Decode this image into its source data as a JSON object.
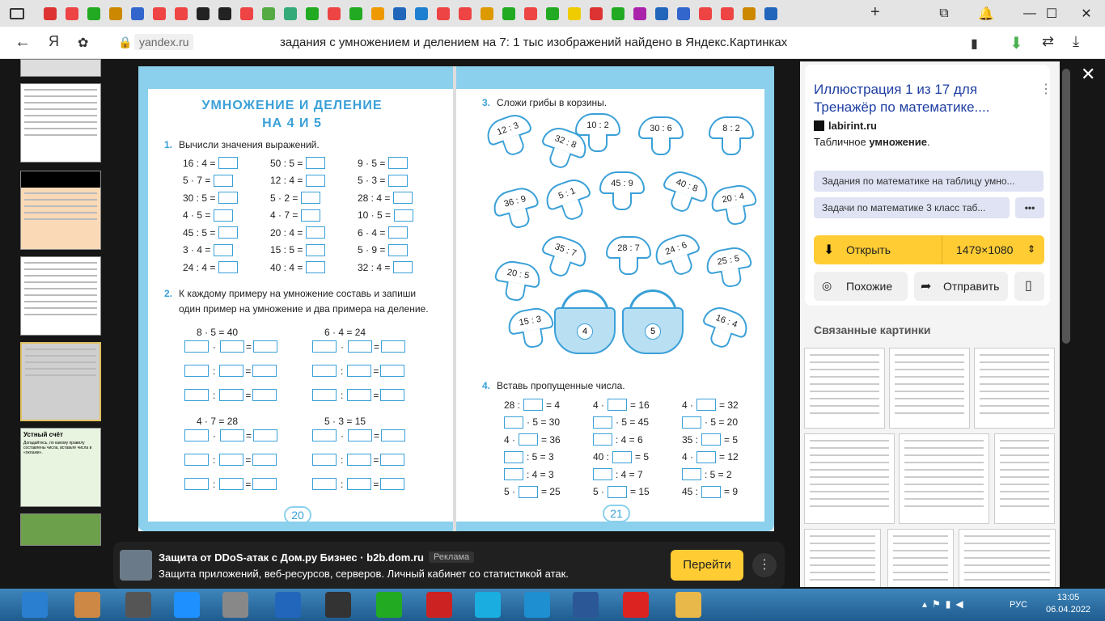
{
  "browser": {
    "address_domain": "yandex.ru",
    "page_title": "задания с умножением и делением на 7: 1 тыс изображений найдено в Яндекс.Картинках"
  },
  "book": {
    "left": {
      "heading1": "УМНОЖЕНИЕ И ДЕЛЕНИЕ",
      "heading2": "НА 4 И 5",
      "task1_num": "1.",
      "task1_text": "Вычисли значения выражений.",
      "col1": [
        "16 : 4 =",
        "5 · 7 =",
        "30 : 5 =",
        "4 · 5 =",
        "45 : 5 =",
        "3 · 4 =",
        "24 : 4 ="
      ],
      "col2": [
        "50 : 5 =",
        "12 : 4 =",
        "5 · 2 =",
        "4 · 7 =",
        "20 : 4 =",
        "15 : 5 =",
        "40 : 4 ="
      ],
      "col3": [
        "9 · 5 =",
        "5 · 3 =",
        "28 : 4 =",
        "10 · 5 =",
        "6 · 4 =",
        "5 · 9 =",
        "32 : 4 ="
      ],
      "task2_num": "2.",
      "task2_text": "К каждому примеру на умножение составь и запиши один пример на умножение и два примера на деление.",
      "examples": [
        "8 · 5 = 40",
        "6 · 4 = 24",
        "4 · 7 = 28",
        "5 · 3 = 15"
      ],
      "page": "20"
    },
    "right": {
      "task3_num": "3.",
      "task3_text": "Сложи грибы в корзины.",
      "mushrooms": [
        "12 : 3",
        "10 : 2",
        "30 : 6",
        "8 : 2",
        "32 : 8",
        "36 : 9",
        "5 : 1",
        "45 : 9",
        "40 : 8",
        "20 : 4",
        "35 : 7",
        "28 : 7",
        "24 : 6",
        "25 : 5",
        "20 : 5",
        "15 : 3",
        "16 : 4"
      ],
      "baskets": [
        "4",
        "5"
      ],
      "task4_num": "4.",
      "task4_text": "Вставь пропущенные числа.",
      "col1": [
        [
          "28 :",
          "= 4"
        ],
        [
          "",
          "· 5 = 30"
        ],
        [
          "4 ·",
          "= 36"
        ],
        [
          "",
          ": 5 = 3"
        ],
        [
          "",
          ": 4 = 3"
        ],
        [
          "5 ·",
          "= 25"
        ]
      ],
      "col2": [
        [
          "4 ·",
          "= 16"
        ],
        [
          "",
          "· 5 = 45"
        ],
        [
          "",
          ": 4 = 6"
        ],
        [
          "40 :",
          "= 5"
        ],
        [
          "",
          ": 4 = 7"
        ],
        [
          "5 ·",
          "= 15"
        ]
      ],
      "col3": [
        [
          "4 ·",
          "= 32"
        ],
        [
          "",
          "· 5 = 20"
        ],
        [
          "35 :",
          "= 5"
        ],
        [
          "4 ·",
          "= 12"
        ],
        [
          "",
          ": 5 = 2"
        ],
        [
          "45 :",
          "= 9"
        ]
      ],
      "page": "21"
    }
  },
  "thumbnail_texts": {
    "ustny": "Устный счёт",
    "ustny_sub": "Догадайтесь, по какому правилу составлены числа, вставьте числа в «окошки»."
  },
  "panel": {
    "title": "Иллюстрация 1 из 17 для Тренажёр по математике....",
    "source": "labirint.ru",
    "desc_prefix": "Табличное ",
    "desc_bold": "умножение",
    "desc_suffix": ".",
    "chip1": "Задания по математике на таблицу умно...",
    "chip2": "Задачи по математике 3 класс таб...",
    "more": "•••",
    "open_label": "Открыть",
    "size": "1479×1080",
    "similar": "Похожие",
    "share": "Отправить",
    "related": "Связанные картинки"
  },
  "ad": {
    "title": "Защита от DDoS-атак с Дом.ру Бизнес · b2b.dom.ru",
    "badge": "Реклама",
    "text": "Защита приложений, веб-ресурсов, серверов. Личный кабинет со статистикой атак.",
    "button": "Перейти"
  },
  "taskbar": {
    "lang": "РУС",
    "time": "13:05",
    "date": "06.04.2022"
  },
  "colors": {
    "accent": "#3aa0d8",
    "yandex_yellow": "#ffcc33"
  }
}
